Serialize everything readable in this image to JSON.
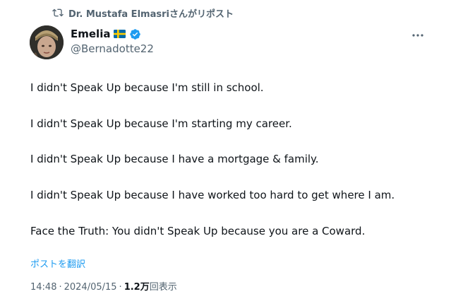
{
  "repost_header": {
    "text": "Dr. Mustafa Elmasriさんがリポスト",
    "icon": "repost-icon"
  },
  "author": {
    "name": "Emelia",
    "flag": "sweden-flag",
    "verified": true,
    "handle": "@Bernadotte22",
    "avatar": "avatar"
  },
  "tweet": {
    "lines": [
      "I didn't Speak Up because I'm still in school.",
      "I didn't Speak Up because I'm starting my career.",
      "I didn't Speak Up because I have a mortgage & family.",
      "I didn't Speak Up because I have worked too hard to get where I am.",
      "Face the Truth: You didn't Speak Up because you are a Coward."
    ],
    "translate_label": "ポストを翻訳"
  },
  "meta": {
    "time": "14:48",
    "date": "2024/05/15",
    "separator": "·",
    "views_count": "1.2万",
    "views_label": "回表示"
  },
  "colors": {
    "accent": "#1d9bf0",
    "secondary_text": "#536471",
    "primary_text": "#0f1419"
  }
}
